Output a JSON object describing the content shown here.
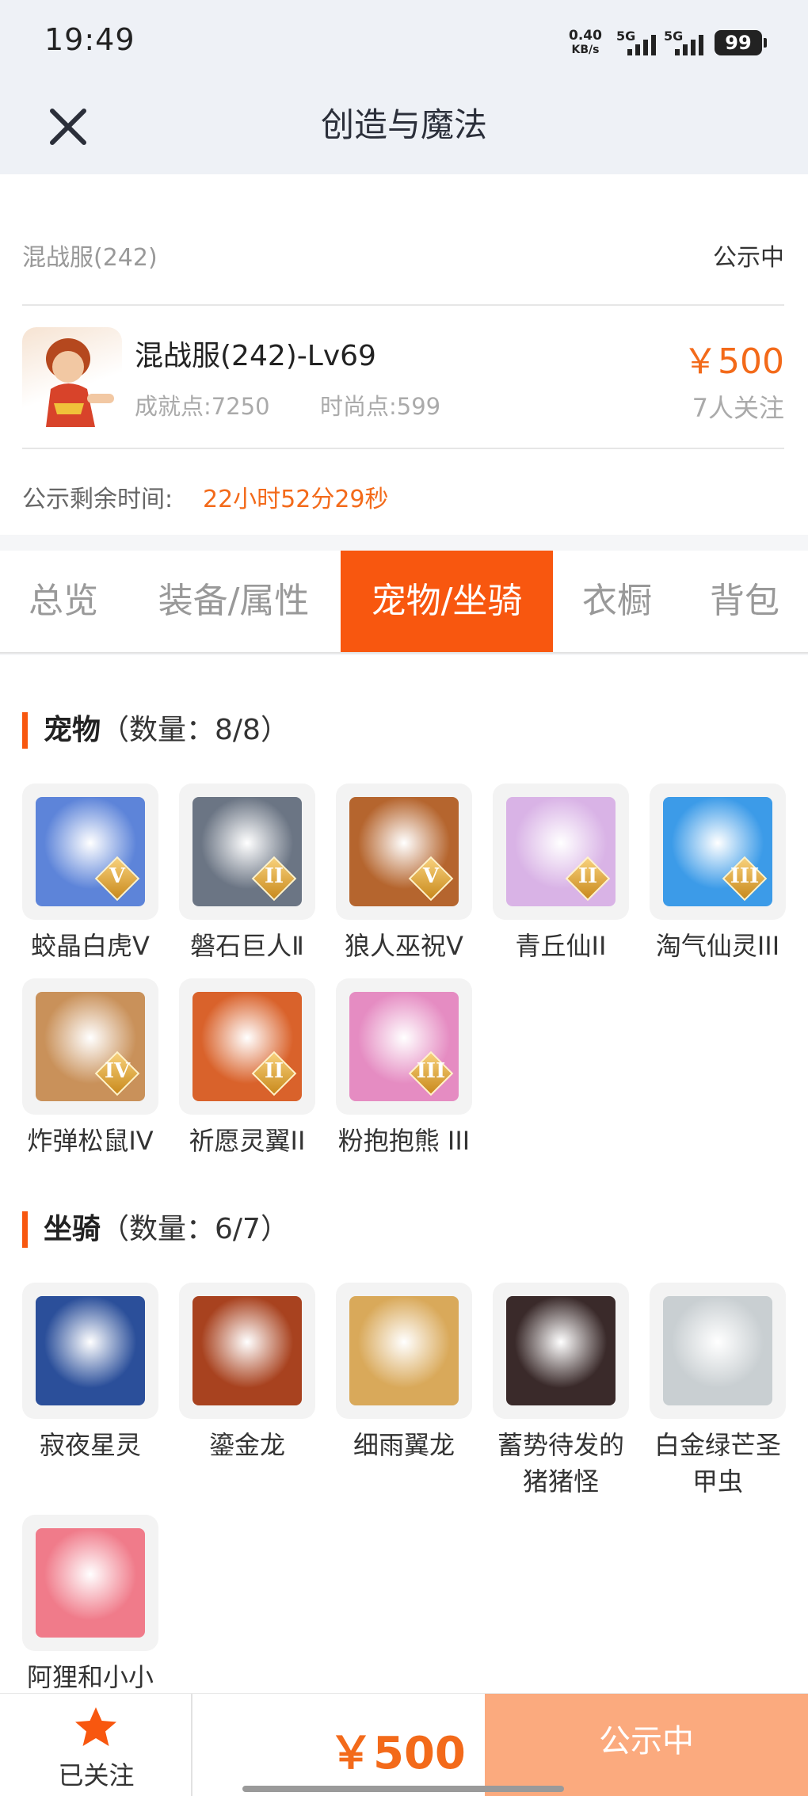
{
  "status_bar": {
    "time": "19:49",
    "net_speed": "0.40",
    "net_unit": "KB/s",
    "signal1": "5G",
    "signal2": "5G",
    "battery": "99"
  },
  "nav": {
    "close_icon": "close-icon",
    "title": "创造与魔法"
  },
  "listing": {
    "server": "混战服(242)",
    "status": "公示中",
    "role_name": "混战服(242)-Lv69",
    "achievement": "成就点:7250",
    "fashion": "时尚点:599",
    "price": "￥500",
    "followers": "7人关注",
    "timer_label": "公示剩余时间:",
    "timer_value": "22小时52分29秒"
  },
  "tabs": [
    {
      "label": "总览",
      "active": false
    },
    {
      "label": "装备/属性",
      "active": false
    },
    {
      "label": "宠物/坐骑",
      "active": true
    },
    {
      "label": "衣橱",
      "active": false
    },
    {
      "label": "背包",
      "active": false
    }
  ],
  "pets": {
    "title": "宠物",
    "count": "（数量：8/8）",
    "items": [
      {
        "name": "蛟晶白虎Ⅴ",
        "rank": "V",
        "color": "#5d84d9"
      },
      {
        "name": "磐石巨人Ⅱ",
        "rank": "II",
        "color": "#6b7584"
      },
      {
        "name": "狼人巫祝Ⅴ",
        "rank": "V",
        "color": "#b5652e"
      },
      {
        "name": "青丘仙II",
        "rank": "II",
        "color": "#d9b3e6"
      },
      {
        "name": "淘气仙灵III",
        "rank": "III",
        "color": "#3c9be8"
      },
      {
        "name": "炸弹松鼠IV",
        "rank": "IV",
        "color": "#c9915a"
      },
      {
        "name": "祈愿灵翼II",
        "rank": "II",
        "color": "#d9622b"
      },
      {
        "name": "粉抱抱熊 III",
        "rank": "III",
        "color": "#e58cc2"
      }
    ]
  },
  "mounts": {
    "title": "坐骑",
    "count": "（数量：6/7）",
    "items": [
      {
        "name": "寂夜星灵",
        "color": "#2b4f9a"
      },
      {
        "name": "鎏金龙",
        "color": "#a8421f"
      },
      {
        "name": "细雨翼龙",
        "color": "#d9a95a"
      },
      {
        "name": "蓄势待发的猪猪怪",
        "color": "#3a2a2a"
      },
      {
        "name": "白金绿芒圣甲虫",
        "color": "#c9cfd2"
      },
      {
        "name": "阿狸和小小",
        "color": "#f07b8a"
      }
    ]
  },
  "bottom_bar": {
    "fav_icon": "star-icon",
    "fav_label": "已关注",
    "price": "￥500",
    "action_label": "公示中"
  },
  "colors": {
    "accent": "#f8570f",
    "price": "#f36a1a",
    "action_bg": "#fbaa7e"
  }
}
